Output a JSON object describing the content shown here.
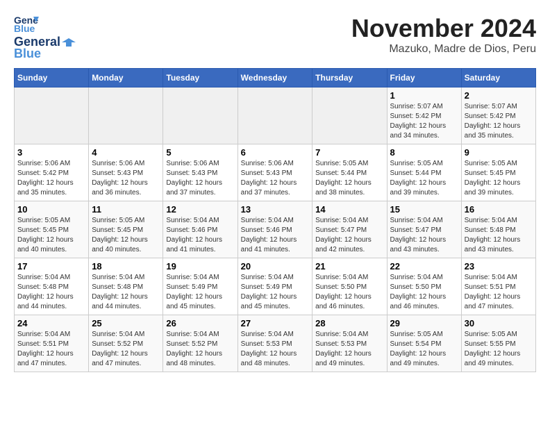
{
  "header": {
    "logo_general": "General",
    "logo_blue": "Blue",
    "title": "November 2024",
    "subtitle": "Mazuko, Madre de Dios, Peru"
  },
  "days_of_week": [
    "Sunday",
    "Monday",
    "Tuesday",
    "Wednesday",
    "Thursday",
    "Friday",
    "Saturday"
  ],
  "weeks": [
    {
      "days": [
        {
          "number": "",
          "info": "",
          "empty": true
        },
        {
          "number": "",
          "info": "",
          "empty": true
        },
        {
          "number": "",
          "info": "",
          "empty": true
        },
        {
          "number": "",
          "info": "",
          "empty": true
        },
        {
          "number": "",
          "info": "",
          "empty": true
        },
        {
          "number": "1",
          "info": "Sunrise: 5:07 AM\nSunset: 5:42 PM\nDaylight: 12 hours\nand 34 minutes."
        },
        {
          "number": "2",
          "info": "Sunrise: 5:07 AM\nSunset: 5:42 PM\nDaylight: 12 hours\nand 35 minutes."
        }
      ]
    },
    {
      "days": [
        {
          "number": "3",
          "info": "Sunrise: 5:06 AM\nSunset: 5:42 PM\nDaylight: 12 hours\nand 35 minutes."
        },
        {
          "number": "4",
          "info": "Sunrise: 5:06 AM\nSunset: 5:43 PM\nDaylight: 12 hours\nand 36 minutes."
        },
        {
          "number": "5",
          "info": "Sunrise: 5:06 AM\nSunset: 5:43 PM\nDaylight: 12 hours\nand 37 minutes."
        },
        {
          "number": "6",
          "info": "Sunrise: 5:06 AM\nSunset: 5:43 PM\nDaylight: 12 hours\nand 37 minutes."
        },
        {
          "number": "7",
          "info": "Sunrise: 5:05 AM\nSunset: 5:44 PM\nDaylight: 12 hours\nand 38 minutes."
        },
        {
          "number": "8",
          "info": "Sunrise: 5:05 AM\nSunset: 5:44 PM\nDaylight: 12 hours\nand 39 minutes."
        },
        {
          "number": "9",
          "info": "Sunrise: 5:05 AM\nSunset: 5:45 PM\nDaylight: 12 hours\nand 39 minutes."
        }
      ]
    },
    {
      "days": [
        {
          "number": "10",
          "info": "Sunrise: 5:05 AM\nSunset: 5:45 PM\nDaylight: 12 hours\nand 40 minutes."
        },
        {
          "number": "11",
          "info": "Sunrise: 5:05 AM\nSunset: 5:45 PM\nDaylight: 12 hours\nand 40 minutes."
        },
        {
          "number": "12",
          "info": "Sunrise: 5:04 AM\nSunset: 5:46 PM\nDaylight: 12 hours\nand 41 minutes."
        },
        {
          "number": "13",
          "info": "Sunrise: 5:04 AM\nSunset: 5:46 PM\nDaylight: 12 hours\nand 41 minutes."
        },
        {
          "number": "14",
          "info": "Sunrise: 5:04 AM\nSunset: 5:47 PM\nDaylight: 12 hours\nand 42 minutes."
        },
        {
          "number": "15",
          "info": "Sunrise: 5:04 AM\nSunset: 5:47 PM\nDaylight: 12 hours\nand 43 minutes."
        },
        {
          "number": "16",
          "info": "Sunrise: 5:04 AM\nSunset: 5:48 PM\nDaylight: 12 hours\nand 43 minutes."
        }
      ]
    },
    {
      "days": [
        {
          "number": "17",
          "info": "Sunrise: 5:04 AM\nSunset: 5:48 PM\nDaylight: 12 hours\nand 44 minutes."
        },
        {
          "number": "18",
          "info": "Sunrise: 5:04 AM\nSunset: 5:48 PM\nDaylight: 12 hours\nand 44 minutes."
        },
        {
          "number": "19",
          "info": "Sunrise: 5:04 AM\nSunset: 5:49 PM\nDaylight: 12 hours\nand 45 minutes."
        },
        {
          "number": "20",
          "info": "Sunrise: 5:04 AM\nSunset: 5:49 PM\nDaylight: 12 hours\nand 45 minutes."
        },
        {
          "number": "21",
          "info": "Sunrise: 5:04 AM\nSunset: 5:50 PM\nDaylight: 12 hours\nand 46 minutes."
        },
        {
          "number": "22",
          "info": "Sunrise: 5:04 AM\nSunset: 5:50 PM\nDaylight: 12 hours\nand 46 minutes."
        },
        {
          "number": "23",
          "info": "Sunrise: 5:04 AM\nSunset: 5:51 PM\nDaylight: 12 hours\nand 47 minutes."
        }
      ]
    },
    {
      "days": [
        {
          "number": "24",
          "info": "Sunrise: 5:04 AM\nSunset: 5:51 PM\nDaylight: 12 hours\nand 47 minutes."
        },
        {
          "number": "25",
          "info": "Sunrise: 5:04 AM\nSunset: 5:52 PM\nDaylight: 12 hours\nand 47 minutes."
        },
        {
          "number": "26",
          "info": "Sunrise: 5:04 AM\nSunset: 5:52 PM\nDaylight: 12 hours\nand 48 minutes."
        },
        {
          "number": "27",
          "info": "Sunrise: 5:04 AM\nSunset: 5:53 PM\nDaylight: 12 hours\nand 48 minutes."
        },
        {
          "number": "28",
          "info": "Sunrise: 5:04 AM\nSunset: 5:53 PM\nDaylight: 12 hours\nand 49 minutes."
        },
        {
          "number": "29",
          "info": "Sunrise: 5:05 AM\nSunset: 5:54 PM\nDaylight: 12 hours\nand 49 minutes."
        },
        {
          "number": "30",
          "info": "Sunrise: 5:05 AM\nSunset: 5:55 PM\nDaylight: 12 hours\nand 49 minutes."
        }
      ]
    }
  ]
}
